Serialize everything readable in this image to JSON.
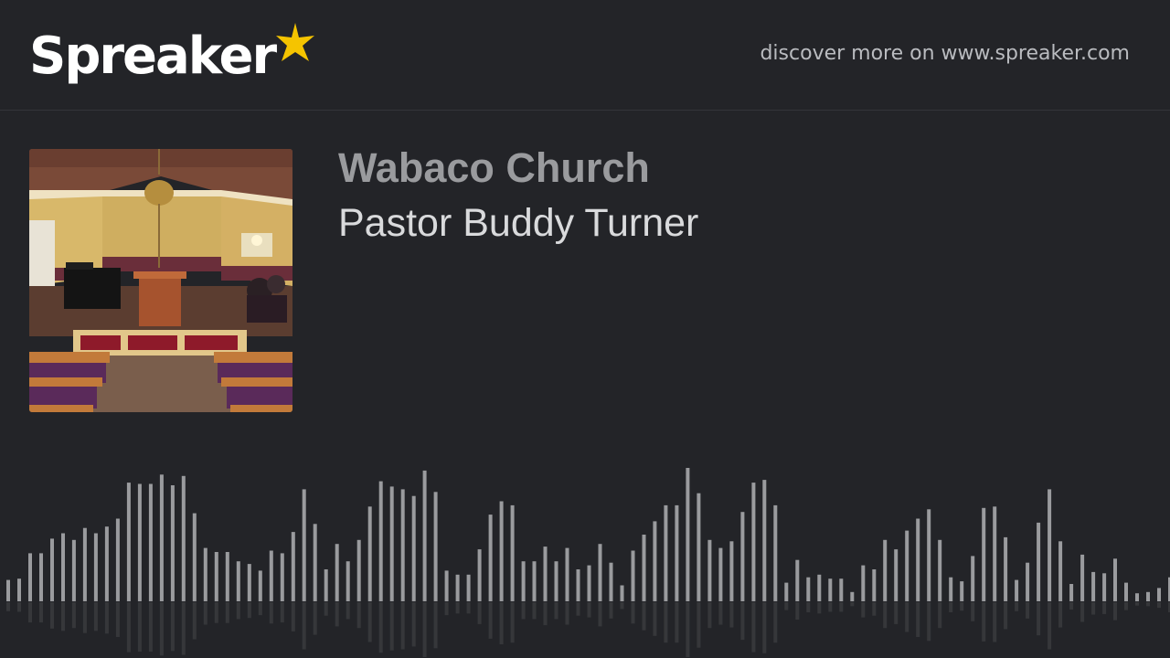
{
  "header": {
    "logo_text": "Spreaker",
    "discover_text": "discover more on www.spreaker.com"
  },
  "episode": {
    "show_title": "Wabaco Church",
    "episode_title": "Pastor Buddy Turner"
  },
  "colors": {
    "background": "#232428",
    "logo_star": "#f5c400",
    "wave_bar": "#9a9b9e"
  },
  "icons": {
    "logo_star": "star-icon"
  },
  "waveform": {
    "levels": [
      0.16,
      0.17,
      0.36,
      0.36,
      0.47,
      0.51,
      0.46,
      0.55,
      0.51,
      0.56,
      0.62,
      0.89,
      0.88,
      0.88,
      0.95,
      0.87,
      0.94,
      0.66,
      0.4,
      0.37,
      0.37,
      0.3,
      0.28,
      0.23,
      0.38,
      0.36,
      0.52,
      0.84,
      0.58,
      0.24,
      0.43,
      0.3,
      0.46,
      0.71,
      0.9,
      0.86,
      0.84,
      0.79,
      0.98,
      0.82,
      0.23,
      0.2,
      0.2,
      0.39,
      0.65,
      0.75,
      0.72,
      0.3,
      0.3,
      0.41,
      0.3,
      0.4,
      0.24,
      0.27,
      0.43,
      0.29,
      0.12,
      0.38,
      0.5,
      0.6,
      0.72,
      0.72,
      1.0,
      0.81,
      0.46,
      0.4,
      0.45,
      0.67,
      0.89,
      0.91,
      0.72,
      0.14,
      0.31,
      0.18,
      0.2,
      0.17,
      0.17,
      0.07,
      0.27,
      0.24,
      0.46,
      0.39,
      0.53,
      0.62,
      0.69,
      0.46,
      0.18,
      0.15,
      0.34,
      0.7,
      0.71,
      0.48,
      0.16,
      0.29,
      0.59,
      0.84,
      0.45,
      0.13,
      0.35,
      0.22,
      0.21,
      0.32,
      0.14,
      0.06,
      0.07,
      0.1,
      0.18
    ]
  }
}
